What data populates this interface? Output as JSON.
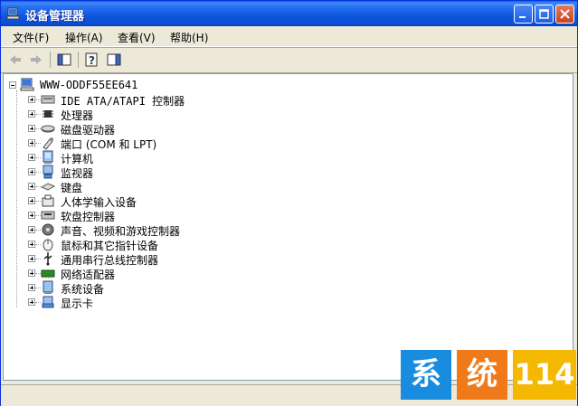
{
  "window": {
    "title": "设备管理器"
  },
  "menu": [
    {
      "label": "文件(F)"
    },
    {
      "label": "操作(A)"
    },
    {
      "label": "查看(V)"
    },
    {
      "label": "帮助(H)"
    }
  ],
  "tree": {
    "root": "WWW-ODDF55EE641",
    "items": [
      {
        "label": "IDE ATA/ATAPI 控制器",
        "icon": "ide-controller-icon"
      },
      {
        "label": "处理器",
        "icon": "processor-icon"
      },
      {
        "label": "磁盘驱动器",
        "icon": "disk-drive-icon"
      },
      {
        "label": "端口 (COM 和 LPT)",
        "icon": "port-icon"
      },
      {
        "label": "计算机",
        "icon": "computer-icon"
      },
      {
        "label": "监视器",
        "icon": "monitor-icon"
      },
      {
        "label": "键盘",
        "icon": "keyboard-icon"
      },
      {
        "label": "人体学输入设备",
        "icon": "hid-icon"
      },
      {
        "label": "软盘控制器",
        "icon": "floppy-controller-icon"
      },
      {
        "label": "声音、视频和游戏控制器",
        "icon": "sound-icon"
      },
      {
        "label": "鼠标和其它指针设备",
        "icon": "mouse-icon"
      },
      {
        "label": "通用串行总线控制器",
        "icon": "usb-icon"
      },
      {
        "label": "网络适配器",
        "icon": "network-adapter-icon"
      },
      {
        "label": "系统设备",
        "icon": "system-device-icon"
      },
      {
        "label": "显示卡",
        "icon": "display-adapter-icon"
      }
    ]
  },
  "watermark": {
    "char1": "系",
    "char2": "统",
    "num": "114"
  },
  "colors": {
    "titlebar": "#0a4fd4",
    "wm_blue": "#1a8ce0",
    "wm_orange": "#f07a1a",
    "wm_yellow": "#f5b800"
  }
}
